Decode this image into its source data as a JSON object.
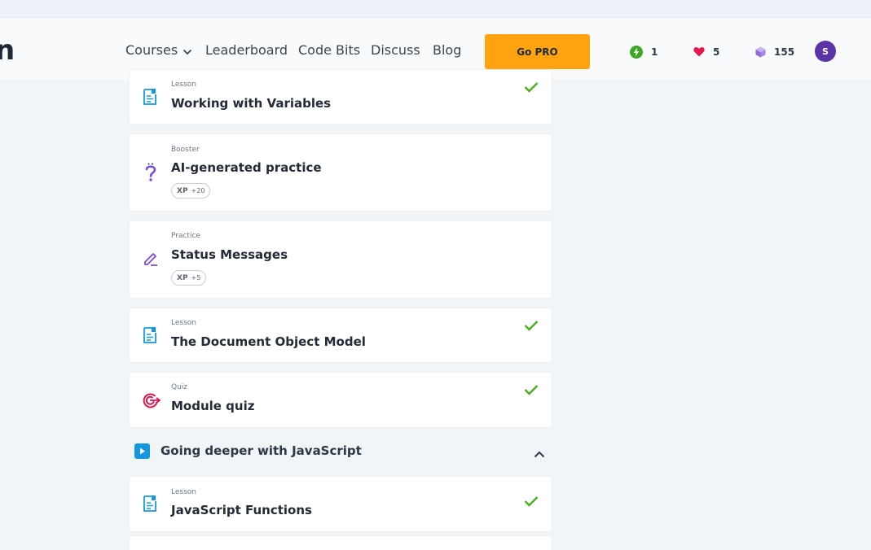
{
  "nav": {
    "logo_fragment": "n",
    "items": [
      {
        "label": "Courses"
      },
      {
        "label": "Leaderboard"
      },
      {
        "label": "Code Bits"
      },
      {
        "label": "Discuss"
      },
      {
        "label": "Blog"
      }
    ],
    "go_pro": "Go PRO",
    "stats": {
      "streak": "1",
      "hearts": "5",
      "bits": "155"
    },
    "avatar_initial": "S"
  },
  "items": [
    {
      "kind": "Lesson",
      "title": "Working with Variables",
      "completed": true
    },
    {
      "kind": "Booster",
      "title": "AI-generated practice",
      "xp_label": "XP",
      "xp_value": "+20"
    },
    {
      "kind": "Practice",
      "title": "Status Messages",
      "xp_label": "XP",
      "xp_value": "+5"
    },
    {
      "kind": "Lesson",
      "title": "The Document Object Model",
      "completed": true
    },
    {
      "kind": "Quiz",
      "title": "Module quiz",
      "completed": true
    }
  ],
  "section": {
    "title": "Going deeper with JavaScript",
    "expanded": true
  },
  "section_items": [
    {
      "kind": "Lesson",
      "title": "JavaScript Functions",
      "completed": true
    }
  ],
  "colors": {
    "accent": "#ffa310",
    "check": "#4caf1f",
    "lesson_icon": "#1597dd",
    "practice_icon": "#7b4fd6",
    "quiz_icon": "#d9184f",
    "avatar": "#5a35a8"
  }
}
